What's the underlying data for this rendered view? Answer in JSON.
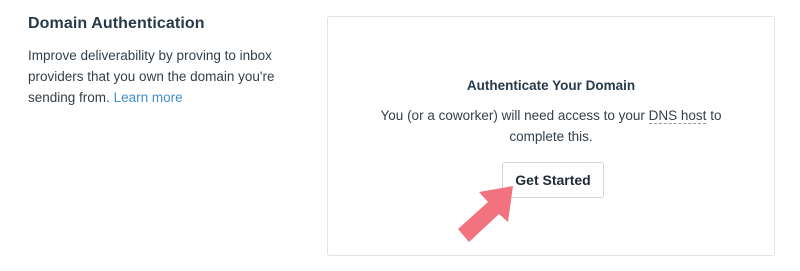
{
  "section": {
    "title": "Domain Authentication",
    "description": "Improve deliverability by proving to inbox providers that you own the domain you're sending from.",
    "learn_more_label": "Learn more"
  },
  "card": {
    "title": "Authenticate Your Domain",
    "text_before": "You (or a coworker) will need access to your ",
    "dns_term": "DNS host",
    "text_after": " to complete this.",
    "button_label": "Get Started"
  },
  "colors": {
    "link": "#3d8ec9",
    "arrow": "#f2727f",
    "border": "#e1e5e8",
    "heading": "#273a4a"
  },
  "icons": {
    "pointer": "arrow-pointer-icon"
  }
}
